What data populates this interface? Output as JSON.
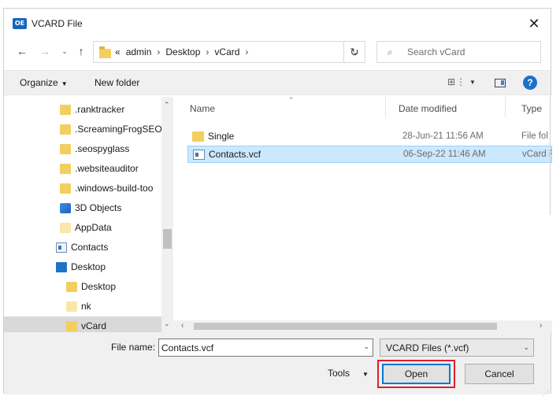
{
  "window": {
    "title": "VCARD File",
    "app_icon_text": "OE",
    "close_glyph": "✕"
  },
  "navigation": {
    "back_glyph": "←",
    "forward_glyph": "→",
    "recent_glyph": "⌄",
    "up_glyph": "↑",
    "overflow_glyph": "«",
    "breadcrumbs": [
      "admin",
      "Desktop",
      "vCard"
    ],
    "separator_glyph": "›",
    "dropdown_glyph": "⌄",
    "refresh_glyph": "↻",
    "search": {
      "placeholder": "Search vCard",
      "value": "",
      "icon_glyph": "⌕"
    }
  },
  "toolbar": {
    "organize_label": "Organize",
    "caret_glyph": "▼",
    "new_folder_label": "New folder",
    "view_glyph": "⊞⋮",
    "help_glyph": "?"
  },
  "nav_pane": {
    "items": [
      {
        "label": ".ranktracker",
        "icon": "folder-icon"
      },
      {
        "label": ".ScreamingFrogSEO",
        "icon": "folder-icon"
      },
      {
        "label": ".seospyglass",
        "icon": "folder-icon"
      },
      {
        "label": ".websiteauditor",
        "icon": "folder-icon"
      },
      {
        "label": ".windows-build-too",
        "icon": "folder-icon"
      },
      {
        "label": "3D Objects",
        "icon": "3d-objects-icon"
      },
      {
        "label": "AppData",
        "icon": "folder-light-icon"
      },
      {
        "label": "Contacts",
        "icon": "contacts-icon"
      },
      {
        "label": "Desktop",
        "icon": "desktop-icon"
      },
      {
        "label": "Desktop",
        "icon": "folder-icon"
      },
      {
        "label": "nk",
        "icon": "folder-light-icon"
      },
      {
        "label": "vCard",
        "icon": "folder-icon",
        "selected": true
      }
    ],
    "scroll_up_glyph": "⌃",
    "scroll_down_glyph": "⌄"
  },
  "file_list": {
    "columns": {
      "name": "Name",
      "date": "Date modified",
      "type": "Type"
    },
    "sort_glyph": "⌃",
    "rows": [
      {
        "name": "Single",
        "date": "28-Jun-21 11:56 AM",
        "type": "File fol",
        "icon": "folder-icon",
        "selected": false
      },
      {
        "name": "Contacts.vcf",
        "date": "06-Sep-22 11:46 AM",
        "type": "vCard F",
        "icon": "vcard-file-icon",
        "selected": true
      }
    ],
    "hscroll_left_glyph": "‹",
    "hscroll_right_glyph": "›"
  },
  "footer": {
    "file_name_label": "File name:",
    "file_name_value": "Contacts.vcf",
    "dropdown_glyph": "⌄",
    "filter_value": "VCARD Files (*.vcf)",
    "tools_label": "Tools",
    "tools_caret": "▼",
    "open_label": "Open",
    "cancel_label": "Cancel",
    "grip_glyph": "⋰"
  },
  "colors": {
    "accent": "#0078d7",
    "highlight_box": "#e0202b",
    "selection": "#cce8ff",
    "folder": "#f3cf5f"
  }
}
